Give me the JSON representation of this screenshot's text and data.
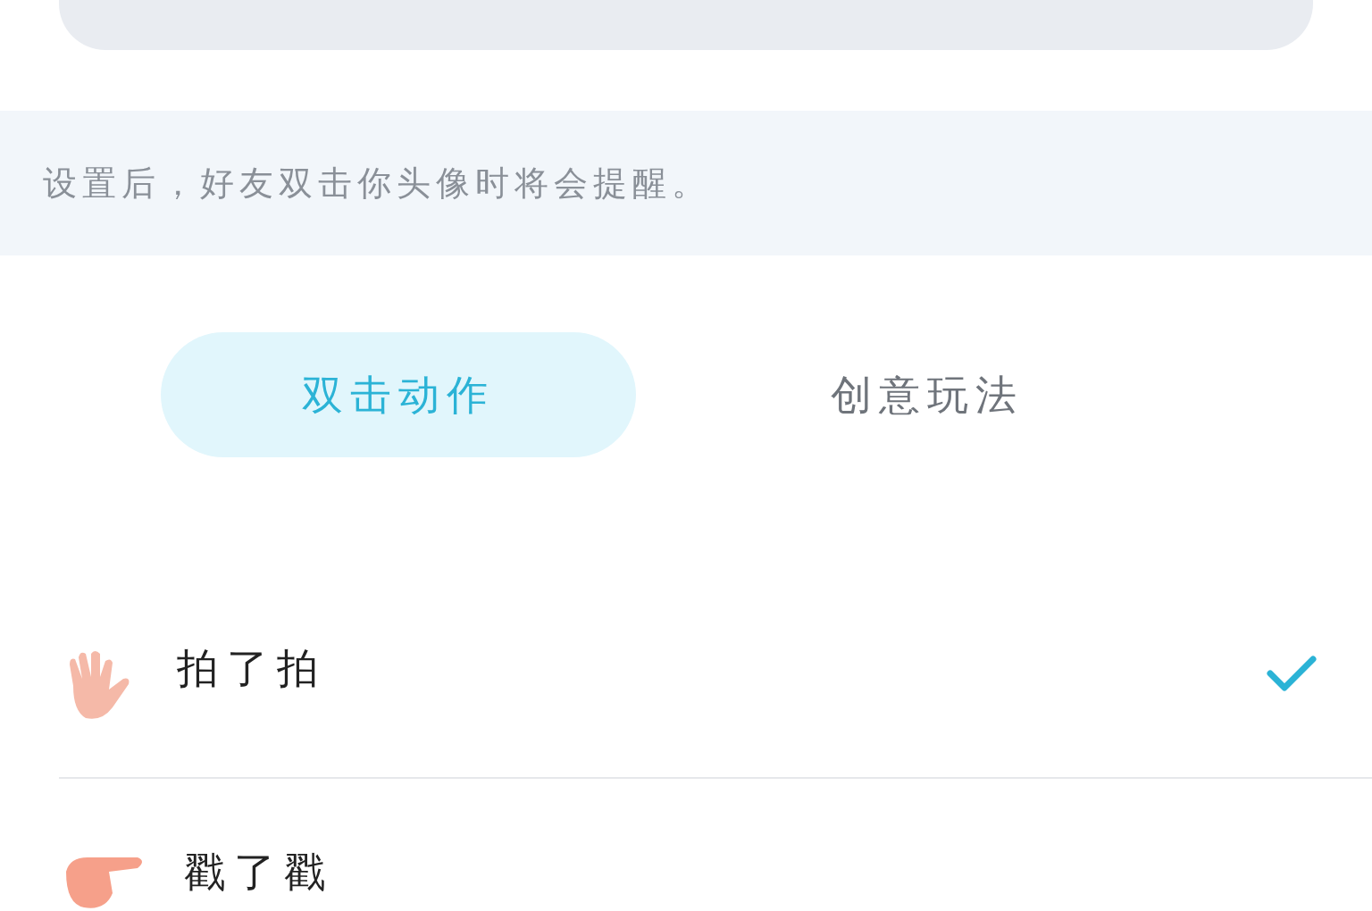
{
  "notice": "设置后，好友双击你头像时将会提醒。",
  "tabs": [
    {
      "label": "双击动作",
      "selected": true
    },
    {
      "label": "创意玩法",
      "selected": false
    }
  ],
  "actions": [
    {
      "label": "拍了拍",
      "kind": "wave",
      "checked": true
    },
    {
      "label": "戳了戳",
      "kind": "poke",
      "checked": false
    }
  ]
}
